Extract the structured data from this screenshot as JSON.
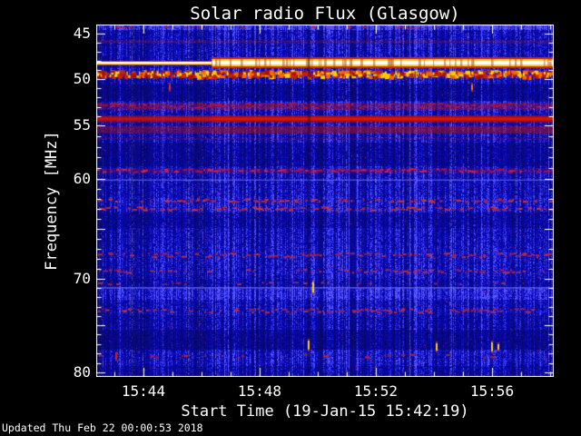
{
  "title": "Solar radio Flux (Glasgow)",
  "x_axis": {
    "label": "Start Time (19-Jan-15 15:42:19)",
    "major_ticks": [
      {
        "label": "15:44",
        "t": 0.1032
      },
      {
        "label": "15:48",
        "t": 0.3571
      },
      {
        "label": "15:52",
        "t": 0.6111
      },
      {
        "label": "15:56",
        "t": 0.8651
      }
    ],
    "minor_start_t": 0.0397,
    "minor_step_t": 0.06349
  },
  "y_axis": {
    "label": "Frequency [MHz]",
    "labeled_ticks": [
      "45",
      "50",
      "55",
      "60",
      "70",
      "80"
    ],
    "major_freqs": [
      45,
      50,
      55,
      60,
      65,
      70,
      75,
      80
    ]
  },
  "footer": {
    "updated": "Updated Thu Feb 22 00:00:53 2018"
  },
  "chart_data": {
    "type": "heatmap",
    "title": "Solar radio Flux (Glasgow)",
    "xlabel": "Start Time (19-Jan-15 15:42:19)",
    "ylabel": "Frequency [MHz]",
    "x_range": [
      "15:42:19",
      "15:58:05"
    ],
    "y_range": [
      44,
      80.5
    ],
    "background": "#000000",
    "base_blue": "#0000a8",
    "frame_color": "#ffffff",
    "freq_anchors": [
      [
        44.0,
        0.0
      ],
      [
        45,
        0.0258
      ],
      [
        50,
        0.1546
      ],
      [
        55,
        0.2861
      ],
      [
        60,
        0.4381
      ],
      [
        65,
        0.5799
      ],
      [
        70,
        0.7216
      ],
      [
        75,
        0.8531
      ],
      [
        80,
        0.9871
      ],
      [
        80.5,
        1.0
      ]
    ],
    "step_t": 0.252,
    "dark_column_t": 0.464,
    "emission_band": {
      "freq": 48.25,
      "note": "narrow white line before step, broad yellow-white band after",
      "colors": {
        "core": "#ffffff",
        "glow": "#ffcc33",
        "fringe": "#cc2a00"
      }
    },
    "zones": [
      [
        44.0,
        44.55,
        1.55
      ],
      [
        48.8,
        49.9,
        1.15
      ],
      [
        50.5,
        52.4,
        0.74
      ],
      [
        52.5,
        53.4,
        1.15
      ],
      [
        56.6,
        58.8,
        0.78
      ],
      [
        61.85,
        63.3,
        1.1
      ],
      [
        63.4,
        64.9,
        0.83
      ],
      [
        66.7,
        69.6,
        1.05
      ],
      [
        70.0,
        70.85,
        0.9
      ],
      [
        71.05,
        72.3,
        1.3
      ],
      [
        73.9,
        75.4,
        0.9
      ],
      [
        75.5,
        77.6,
        0.72
      ],
      [
        77.7,
        79.1,
        1.05
      ],
      [
        79.3,
        80.6,
        0.88
      ]
    ],
    "tint_rows": [
      {
        "f0": 45.75,
        "f1": 46.05,
        "rgb": "170,30,30",
        "alpha": 0.3,
        "alpha_right": 0.3
      },
      {
        "f0": 52.55,
        "f1": 53.35,
        "rgb": "170,17,51",
        "alpha": 0.3,
        "alpha_right": 0.35
      },
      {
        "f0": 53.95,
        "f1": 54.65,
        "rgb": "192,8,0",
        "alpha": 0.72,
        "alpha_right": 0.92
      },
      {
        "f0": 54.15,
        "f1": 54.45,
        "rgb": "225,35,0",
        "alpha": 0.45,
        "alpha_right": 0.65
      },
      {
        "f0": 55.05,
        "f1": 55.75,
        "rgb": "176,16,16",
        "alpha": 0.45,
        "alpha_right": 0.55
      },
      {
        "f0": 56.15,
        "f1": 56.35,
        "rgb": "150,20,40",
        "alpha": 0.25,
        "alpha_right": 0.25
      },
      {
        "f0": 59.0,
        "f1": 59.45,
        "rgb": "160,16,68",
        "alpha": 0.25,
        "alpha_right": 0.25
      }
    ],
    "blue_lines": [
      {
        "f": 60.05,
        "alpha": 0.55
      },
      {
        "f": 70.9,
        "alpha": 0.7
      }
    ],
    "dash_rows": [
      {
        "f0": 44.15,
        "f1": 44.5,
        "density": 0.35,
        "colors": [
          "#cc2233",
          "#99223a"
        ]
      },
      {
        "f0": 49.0,
        "f1": 49.85,
        "density": 0.9,
        "colors": [
          "#cc2200",
          "#ff6600",
          "#ffcc00",
          "#aa1100"
        ],
        "tall": true
      },
      {
        "f0": 52.55,
        "f1": 53.3,
        "density": 0.5,
        "colors": [
          "#b01535",
          "#8a1030"
        ]
      },
      {
        "f0": 59.0,
        "f1": 59.45,
        "density": 0.5,
        "colors": [
          "#aa1144",
          "#cc2244"
        ]
      },
      {
        "f0": 61.95,
        "f1": 62.4,
        "density": 0.5,
        "colors": [
          "#aa2244",
          "#cc3333"
        ]
      },
      {
        "f0": 62.75,
        "f1": 63.25,
        "density": 0.5,
        "colors": [
          "#aa2244",
          "#cc3333"
        ]
      },
      {
        "f0": 67.35,
        "f1": 67.95,
        "density": 0.45,
        "colors": [
          "#992255",
          "#b32a4a"
        ]
      },
      {
        "f0": 69.0,
        "f1": 69.5,
        "density": 0.4,
        "colors": [
          "#992255",
          "#b32a4a"
        ]
      },
      {
        "f0": 70.3,
        "f1": 70.7,
        "density": 0.35,
        "colors": [
          "#8a2150",
          "#a03060"
        ]
      },
      {
        "f0": 73.15,
        "f1": 73.75,
        "density": 0.45,
        "colors": [
          "#992255",
          "#b32a4a"
        ]
      },
      {
        "f0": 78.05,
        "f1": 78.55,
        "density": 0.25,
        "colors": [
          "#bb2233",
          "#992233"
        ]
      }
    ],
    "events": [
      {
        "t": 0.473,
        "f": 70.9,
        "h": 12,
        "color": "#ffcc22"
      },
      {
        "t": 0.462,
        "f": 77.1,
        "h": 10,
        "color": "#ffcc22"
      },
      {
        "t": 0.742,
        "f": 77.3,
        "h": 8,
        "color": "#ffcc22"
      },
      {
        "t": 0.863,
        "f": 77.3,
        "h": 10,
        "color": "#ffcc22"
      },
      {
        "t": 0.877,
        "f": 77.3,
        "h": 6,
        "color": "#ffcc22"
      },
      {
        "t": 0.042,
        "f": 78.3,
        "h": 6,
        "color": "#dd2200"
      },
      {
        "t": 0.159,
        "f": 50.9,
        "h": 5,
        "color": "#ee3300"
      },
      {
        "t": 0.819,
        "f": 50.9,
        "h": 6,
        "color": "#ff7711"
      }
    ]
  }
}
